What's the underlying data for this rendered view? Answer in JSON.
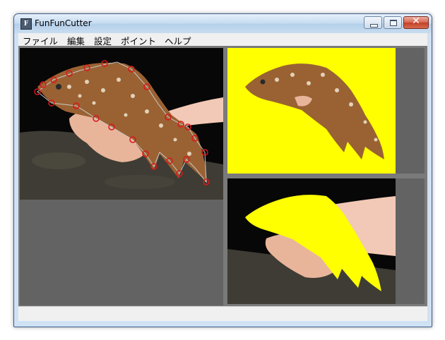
{
  "window": {
    "title": "FunFunCutter",
    "icon": "app-icon",
    "controls": [
      "minimize-icon",
      "maximize-icon",
      "close-icon"
    ]
  },
  "menu": {
    "items": [
      "ファイル",
      "編集",
      "設定",
      "ポイント",
      "ヘルプ"
    ]
  },
  "panes": {
    "editor": "photo of a fish held in a hand, with an outline of red control points around the fish",
    "cutout_preview": "fish cut out on a yellow background",
    "mask_preview": "photo with the fish region filled in yellow"
  },
  "colors": {
    "point_marker": "#d91818",
    "fill": "#ffff00",
    "panel_background": "#636363"
  },
  "statusbar": {
    "text": ""
  }
}
